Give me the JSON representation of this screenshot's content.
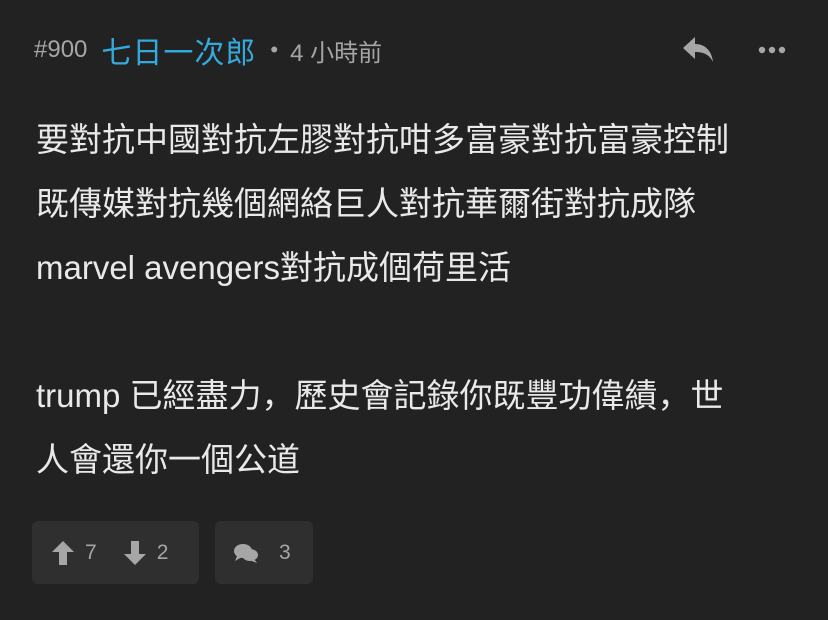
{
  "post": {
    "floor": "#900",
    "username": "七日一次郎",
    "separator": "•",
    "time": "4 小時前",
    "content_lines": [
      "要對抗中國對抗左膠對抗咁多富豪對抗富豪控制",
      "既傳媒對抗幾個網絡巨人對抗華爾街對抗成隊",
      "marvel avengers對抗成個荷里活",
      "trump 已經盡力，歷史會記錄你既豐功偉績，世",
      "人會還你一個公道"
    ],
    "upvotes": "7",
    "downvotes": "2",
    "comments": "3"
  },
  "icons": {
    "reply": "reply-arrow-icon",
    "more": "more-dots-icon",
    "upvote": "arrow-up-icon",
    "downvote": "arrow-down-icon",
    "comment": "comment-bubbles-icon"
  },
  "colors": {
    "background": "#222222",
    "username": "#34aadc",
    "meta": "#a6a6a6",
    "text": "#e9e9e9",
    "button_bg": "#2f2f2f"
  }
}
